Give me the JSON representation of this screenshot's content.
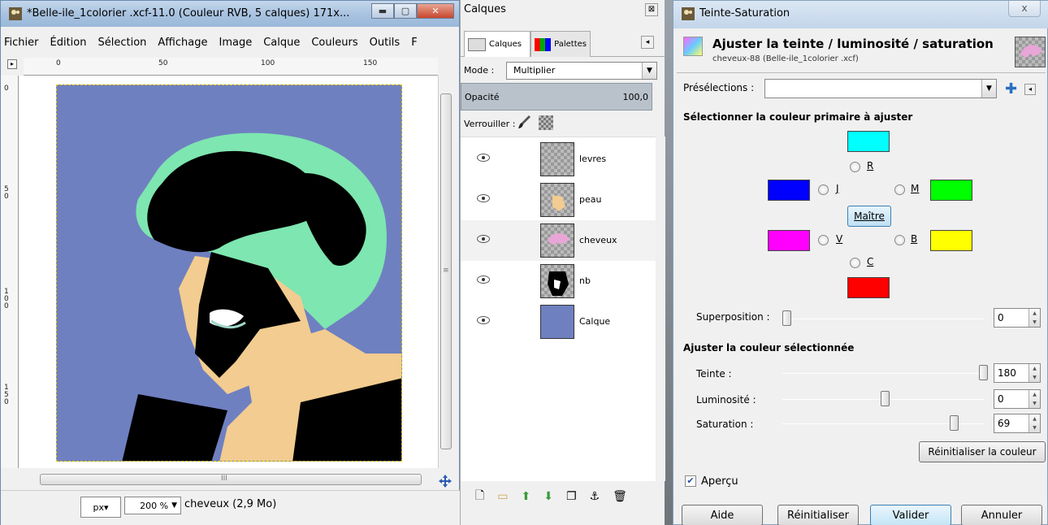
{
  "image_window": {
    "title": "*Belle-ile_1colorier .xcf-11.0 (Couleur RVB, 5 calques) 171x...",
    "menu": [
      "Fichier",
      "Édition",
      "Sélection",
      "Affichage",
      "Image",
      "Calque",
      "Couleurs",
      "Outils",
      "F"
    ],
    "ruler_h_ticks": [
      "0",
      "50",
      "100",
      "150"
    ],
    "ruler_v_ticks": [
      "0",
      "5\n0",
      "1\n0\n0",
      "1\n5\n0"
    ],
    "unit": "px▾",
    "zoom": "200 %",
    "status": "cheveux (2,9 Mo)",
    "hscroll_mid": "III",
    "vscroll_mid": "≡"
  },
  "layers_panel": {
    "title": "Calques",
    "tabs": [
      "Calques",
      "Palettes"
    ],
    "mode_label": "Mode :",
    "mode_value": "Multiplier",
    "opacity_label": "Opacité",
    "opacity_value": "100,0",
    "lock_label": "Verrouiller :",
    "layers": [
      {
        "name": "levres"
      },
      {
        "name": "peau"
      },
      {
        "name": "cheveux"
      },
      {
        "name": "nb"
      },
      {
        "name": "Calque"
      }
    ]
  },
  "huesat": {
    "title": "Teinte-Saturation",
    "close": "x",
    "heading": "Ajuster la teinte / luminosité / saturation",
    "subheading": "cheveux-88 (Belle-ile_1colorier .xcf)",
    "presets_label": "Présélections :",
    "primary_heading": "Sélectionner la couleur primaire à ajuster",
    "radios": {
      "r": "R",
      "j": "J",
      "m": "M",
      "v": "V",
      "b": "B",
      "c": "C"
    },
    "master_label": "Maître",
    "overlap_label": "Superposition :",
    "overlap_value": "0",
    "adjust_heading": "Ajuster la couleur sélectionnée",
    "hue_label": "Teinte :",
    "hue_value": "180",
    "lightness_label": "Luminosité :",
    "lightness_value": "0",
    "saturation_label": "Saturation :",
    "saturation_value": "69",
    "reset_color_label": "Réinitialiser la couleur",
    "preview_label": "Aperçu",
    "buttons": {
      "help": "Aide",
      "reset": "Réinitialiser",
      "ok": "Valider",
      "cancel": "Annuler"
    },
    "colors": {
      "cyan": "#00ffff",
      "blue": "#0000ff",
      "green": "#00ff00",
      "magenta": "#ff00ff",
      "yellow": "#ffff00",
      "red": "#ff0000"
    }
  },
  "icons": [
    "gimp-app-icon",
    "eye-icon",
    "paintbrush-icon",
    "checker-icon",
    "new-layer-icon",
    "folder-icon",
    "raise-icon",
    "lower-icon",
    "duplicate-icon",
    "anchor-icon",
    "trash-icon",
    "add-preset-icon",
    "navigate-icon"
  ]
}
